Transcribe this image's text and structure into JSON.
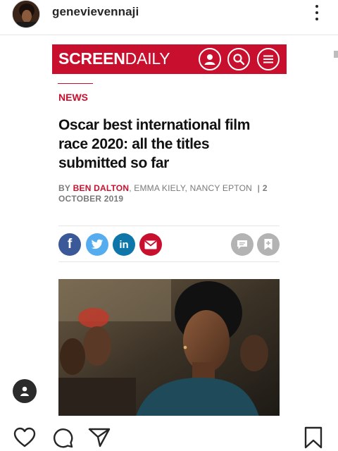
{
  "post": {
    "username": "genevievennaji"
  },
  "site": {
    "logo_bold": "SCREEN",
    "logo_light": "DAILY",
    "brand_color": "#c8102e"
  },
  "article": {
    "section": "NEWS",
    "headline": "Oscar best international film race 2020: all the titles submitted so far",
    "byline_prefix": "BY",
    "author": "BEN DALTON",
    "other_authors": ", EMMA KIELY, NANCY EPTON",
    "separator": "|",
    "date": "2 OCTOBER 2019"
  },
  "share": {
    "facebook": "f",
    "facebook_color": "#3b5998",
    "twitter_color": "#55acee",
    "linkedin": "in",
    "linkedin_color": "#0e76a8",
    "email_color": "#c8102e",
    "utility_color": "#b3b3b3"
  },
  "icons": [
    "more-icon",
    "user-icon",
    "search-icon",
    "menu-icon",
    "facebook-icon",
    "twitter-icon",
    "linkedin-icon",
    "email-icon",
    "comment-icon",
    "bookmark-add-icon",
    "heart-icon",
    "comment-bubble-icon",
    "send-icon",
    "save-icon"
  ]
}
